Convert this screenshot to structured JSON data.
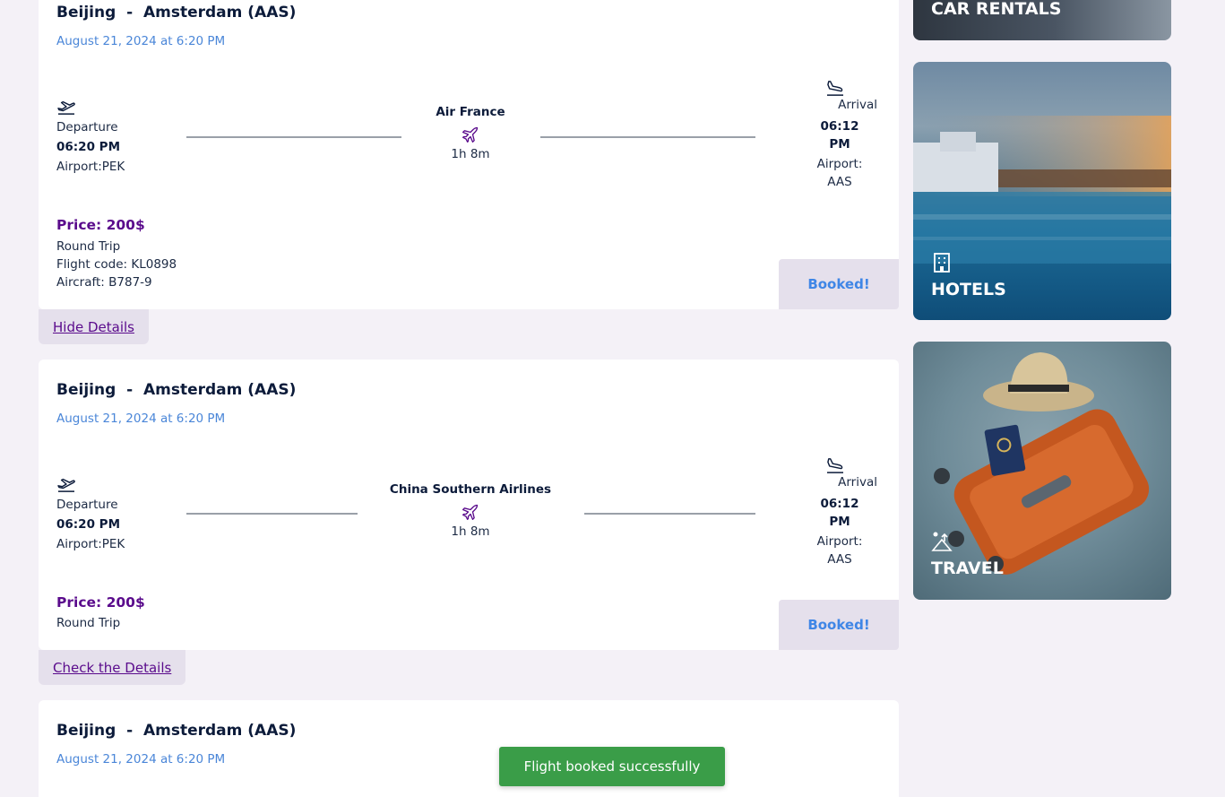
{
  "flights": [
    {
      "route": "Beijing  -  Amsterdam (AAS)",
      "date": "August 21, 2024 at 6:20 PM",
      "departure_label": "Departure",
      "departure_time": "06:20 PM",
      "departure_airport": "Airport:PEK",
      "airline": "Air France",
      "duration": "1h 8m",
      "arrival_label": "Arrival",
      "arrival_time_1": "06:12",
      "arrival_time_2": "PM",
      "arrival_airport_1": "Airport:",
      "arrival_airport_2": "AAS",
      "price": "Price: 200$",
      "trip_type": "Round Trip",
      "flight_code": "Flight code: KL0898",
      "aircraft": "Aircraft: B787-9",
      "status": "Booked!",
      "details_toggle": "Hide Details"
    },
    {
      "route": "Beijing  -  Amsterdam (AAS)",
      "date": "August 21, 2024 at 6:20 PM",
      "departure_label": "Departure",
      "departure_time": "06:20 PM",
      "departure_airport": "Airport:PEK",
      "airline": "China Southern Airlines",
      "duration": "1h 8m",
      "arrival_label": "Arrival",
      "arrival_time_1": "06:12",
      "arrival_time_2": "PM",
      "arrival_airport_1": "Airport:",
      "arrival_airport_2": "AAS",
      "price": "Price: 200$",
      "trip_type": "Round Trip",
      "status": "Booked!",
      "details_toggle": "Check the Details"
    },
    {
      "route": "Beijing  -  Amsterdam (AAS)",
      "date": "August 21, 2024 at 6:20 PM"
    }
  ],
  "sidebar": {
    "car_rentals": "CAR RENTALS",
    "hotels": "HOTELS",
    "travel": "TRAVEL"
  },
  "toast": "Flight booked successfully",
  "colors": {
    "accent_purple": "#5a0b8c",
    "link_blue": "#4a86d8",
    "booked_blue": "#3f86e6",
    "toast_green": "#3a9d48"
  },
  "icons": [
    "plane-takeoff-icon",
    "plane-icon",
    "plane-landing-icon",
    "building-icon",
    "beach-icon"
  ]
}
